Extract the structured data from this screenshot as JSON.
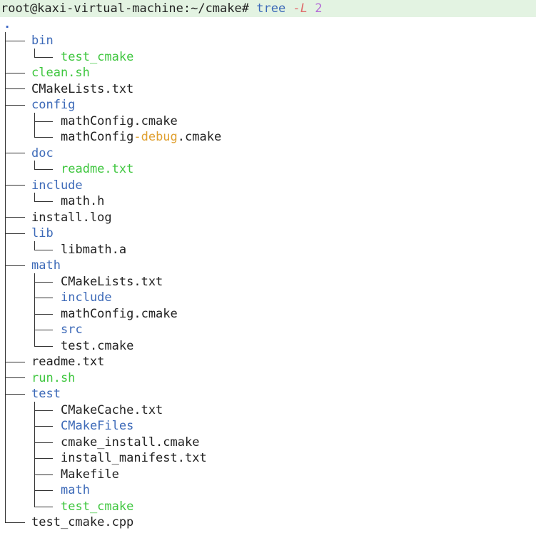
{
  "prompt": {
    "user_host_path": "root@kaxi-virtual-machine:~/cmake#",
    "command": "tree",
    "flag": "-L",
    "arg": "2"
  },
  "tree": {
    "root": ".",
    "entries": [
      {
        "label": "bin",
        "kind": "dir"
      },
      {
        "label": "test_cmake",
        "kind": "exec"
      },
      {
        "label": "clean.sh",
        "kind": "exec"
      },
      {
        "label": "CMakeLists.txt",
        "kind": "file"
      },
      {
        "label": "config",
        "kind": "dir"
      },
      {
        "label": "mathConfig.cmake",
        "kind": "file"
      },
      {
        "label_parts": [
          "mathConfig",
          "-debug",
          ".cmake"
        ],
        "kind": "file"
      },
      {
        "label": "doc",
        "kind": "dir"
      },
      {
        "label": "readme.txt",
        "kind": "exec"
      },
      {
        "label": "include",
        "kind": "dir"
      },
      {
        "label": "math.h",
        "kind": "file"
      },
      {
        "label": "install.log",
        "kind": "file"
      },
      {
        "label": "lib",
        "kind": "dir"
      },
      {
        "label": "libmath.a",
        "kind": "file"
      },
      {
        "label": "math",
        "kind": "dir"
      },
      {
        "label": "CMakeLists.txt",
        "kind": "file"
      },
      {
        "label": "include",
        "kind": "dir"
      },
      {
        "label": "mathConfig.cmake",
        "kind": "file"
      },
      {
        "label": "src",
        "kind": "dir"
      },
      {
        "label": "test.cmake",
        "kind": "file"
      },
      {
        "label": "readme.txt",
        "kind": "file"
      },
      {
        "label": "run.sh",
        "kind": "exec"
      },
      {
        "label": "test",
        "kind": "dir"
      },
      {
        "label": "CMakeCache.txt",
        "kind": "file"
      },
      {
        "label": "CMakeFiles",
        "kind": "dir"
      },
      {
        "label": "cmake_install.cmake",
        "kind": "file"
      },
      {
        "label": "install_manifest.txt",
        "kind": "file"
      },
      {
        "label": "Makefile",
        "kind": "file"
      },
      {
        "label": "math",
        "kind": "dir"
      },
      {
        "label": "test_cmake",
        "kind": "exec"
      },
      {
        "label": "test_cmake.cpp",
        "kind": "file"
      }
    ]
  },
  "colors": {
    "dir": "#3d6ab8",
    "exec": "#3ec63e",
    "file": "#222222",
    "prompt_bg": "#e3f3e2",
    "flag": "#e06a6a",
    "number": "#b36ad6",
    "highlight": "#e0a030"
  }
}
